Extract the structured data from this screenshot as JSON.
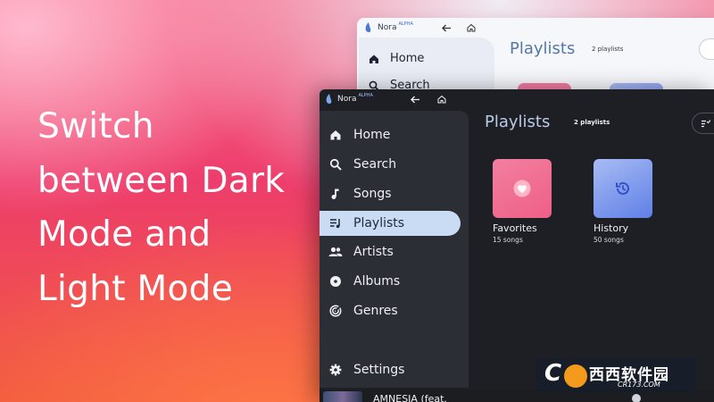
{
  "headline": [
    "Switch",
    "between Dark",
    "Mode and",
    "Light Mode"
  ],
  "app": {
    "name": "Nora",
    "badge": "ALPHA"
  },
  "light_window": {
    "nav": [
      "Home",
      "Search"
    ],
    "page_title": "Playlists",
    "playlist_count": "2 playlists"
  },
  "dark_window": {
    "nav": [
      "Home",
      "Search",
      "Songs",
      "Playlists",
      "Artists",
      "Albums",
      "Genres"
    ],
    "active_nav": "Playlists",
    "settings": "Settings",
    "page_title": "Playlists",
    "playlist_count": "2 playlists",
    "playlists": [
      {
        "name": "Favorites",
        "count": "15 songs",
        "icon": "heart-icon",
        "color": "#f06b93"
      },
      {
        "name": "History",
        "count": "50 songs",
        "icon": "history-icon",
        "color": "#7f93e8"
      }
    ],
    "now_playing": "AMNESIA (feat."
  },
  "colors": {
    "active_nav_bg": "#c9dcf4",
    "sidebar_dark": "#2b2e34",
    "title_blue": "#b9cbe6"
  },
  "watermark": {
    "brand": "西西软件园",
    "site": "CR173.COM"
  }
}
